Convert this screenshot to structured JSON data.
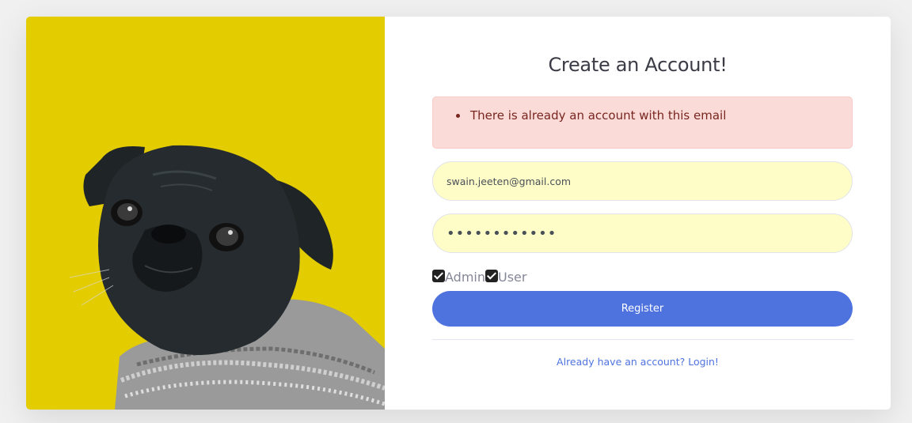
{
  "page": {
    "title": "Create an Account!"
  },
  "alert": {
    "messages": [
      "There is already an account with this email"
    ]
  },
  "form": {
    "email_value": "swain.jeeten@gmail.com",
    "password_value": "••••••••••••",
    "roles": [
      {
        "label": "Admin",
        "checked": true
      },
      {
        "label": "User",
        "checked": true
      }
    ],
    "register_label": "Register",
    "login_link": "Already have an account? Login!"
  },
  "colors": {
    "photo_background": "#e3cc00",
    "primary": "#4e73df",
    "alert_bg": "#fadbd8",
    "autofill_bg": "#fefdc8"
  },
  "icons": {
    "photo": "pug-dog-illustration"
  }
}
